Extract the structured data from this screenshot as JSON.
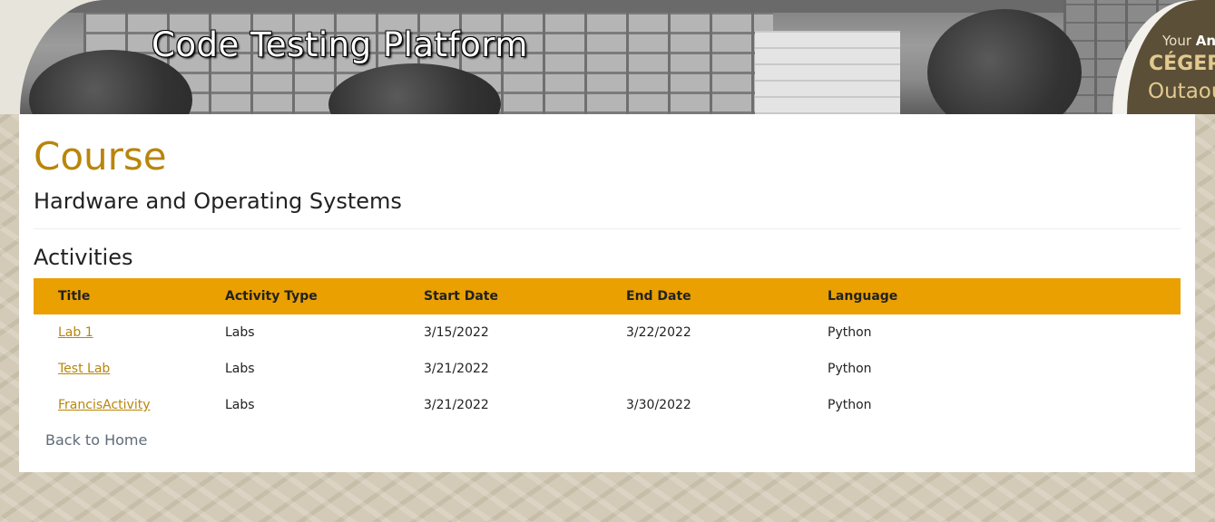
{
  "header": {
    "site_title": "Code Testing Platform",
    "logo": {
      "line1_prefix": "Your ",
      "line1_bold": "An",
      "line2": "CÉGEP",
      "line3": "Outaou"
    }
  },
  "page": {
    "heading": "Course",
    "course_name": "Hardware and Operating Systems",
    "section_title": "Activities"
  },
  "table": {
    "columns": [
      "Title",
      "Activity Type",
      "Start Date",
      "End Date",
      "Language"
    ],
    "rows": [
      {
        "title": "Lab 1",
        "type": "Labs",
        "start": "3/15/2022",
        "end": "3/22/2022",
        "language": "Python"
      },
      {
        "title": "Test Lab",
        "type": "Labs",
        "start": "3/21/2022",
        "end": "",
        "language": "Python"
      },
      {
        "title": "FrancisActivity",
        "type": "Labs",
        "start": "3/21/2022",
        "end": "3/30/2022",
        "language": "Python"
      }
    ]
  },
  "nav": {
    "back_label": "Back to Home"
  },
  "colors": {
    "accent": "#b8860b",
    "table_header": "#e9a000",
    "logo_bg": "#5b4f37"
  }
}
